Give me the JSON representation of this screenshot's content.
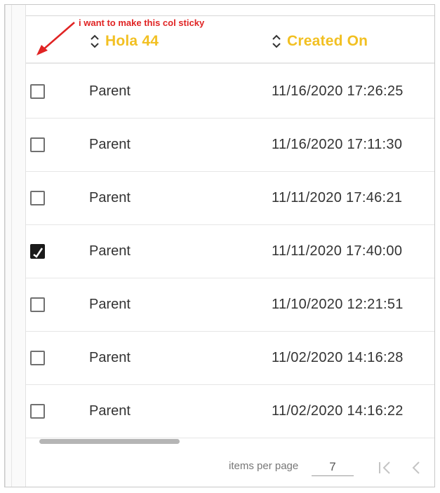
{
  "annotation": {
    "text": "i want to make this col sticky"
  },
  "table": {
    "columns": [
      {
        "label": "Hola 44"
      },
      {
        "label": "Created On"
      }
    ],
    "rows": [
      {
        "checked": false,
        "type": "Parent",
        "created": "11/16/2020 17:26:25"
      },
      {
        "checked": false,
        "type": "Parent",
        "created": "11/16/2020 17:11:30"
      },
      {
        "checked": false,
        "type": "Parent",
        "created": "11/11/2020 17:46:21"
      },
      {
        "checked": true,
        "type": "Parent",
        "created": "11/11/2020 17:40:00"
      },
      {
        "checked": false,
        "type": "Parent",
        "created": "11/10/2020 12:21:51"
      },
      {
        "checked": false,
        "type": "Parent",
        "created": "11/02/2020 14:16:28"
      },
      {
        "checked": false,
        "type": "Parent",
        "created": "11/02/2020 14:16:22"
      }
    ]
  },
  "paginator": {
    "items_per_page_label": "items per page",
    "page_size": "7"
  },
  "colors": {
    "header_text": "#f2c022",
    "annotation": "#e02323"
  }
}
